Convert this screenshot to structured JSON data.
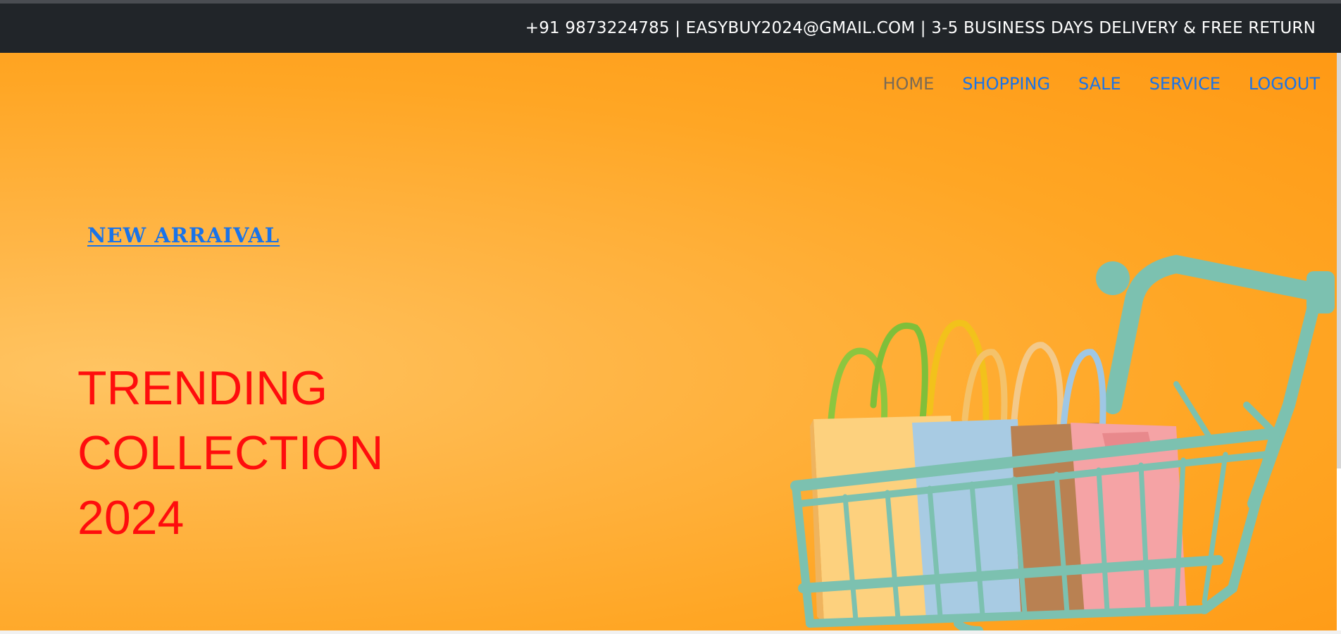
{
  "topbar": {
    "info": "+91 9873224785 | EASYBUY2024@GMAIL.COM | 3-5 BUSINESS DAYS DELIVERY & FREE RETURN"
  },
  "nav": {
    "items": [
      {
        "label": "HOME",
        "active": true
      },
      {
        "label": "SHOPPING",
        "active": false
      },
      {
        "label": "SALE",
        "active": false
      },
      {
        "label": "SERVICE",
        "active": false
      },
      {
        "label": "LOGOUT",
        "active": false
      }
    ]
  },
  "hero": {
    "new_arrival": "NEW ARRAIVAL",
    "title_line1": "TRENDING COLLECTION",
    "title_line2": "2024",
    "image": "shopping-cart-with-bags-image"
  },
  "colors": {
    "topbar_bg": "#212529",
    "hero_bg": "#ffa624",
    "nav_link": "#1a73e8",
    "nav_active": "#7a6a55",
    "title": "#ff0d0d",
    "cart": "#7cc1b0"
  }
}
